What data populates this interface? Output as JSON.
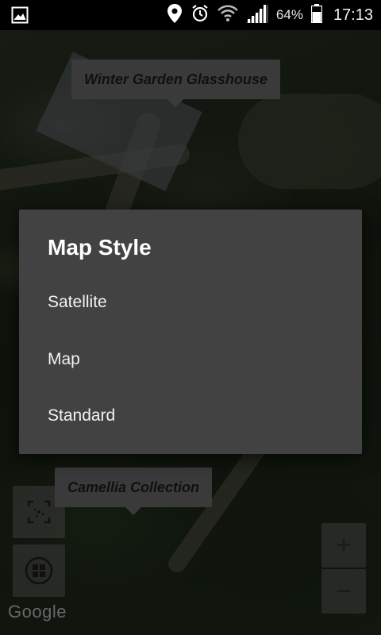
{
  "status_bar": {
    "battery": "64%",
    "time": "17:13",
    "icons": [
      "image-notification-icon",
      "location-pin-icon",
      "alarm-clock-icon",
      "wifi-icon",
      "signal-icon",
      "battery-icon"
    ]
  },
  "map": {
    "labels": {
      "top": "Winter Garden Glasshouse",
      "bottom": "Camellia Collection"
    },
    "attribution": "Google",
    "controls": {
      "zoom_in": "+",
      "zoom_out": "−"
    }
  },
  "dialog": {
    "title": "Map Style",
    "options": [
      "Satellite",
      "Map",
      "Standard"
    ]
  }
}
